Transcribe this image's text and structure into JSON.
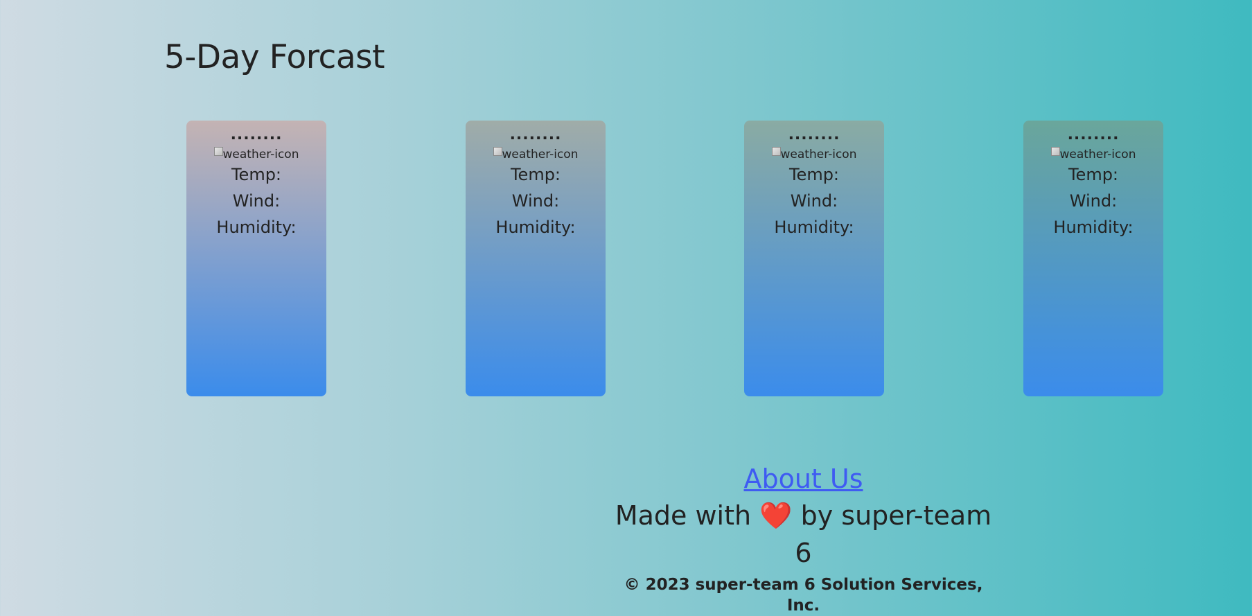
{
  "page": {
    "title": "5-Day Forcast"
  },
  "forecast": {
    "cards": [
      {
        "date": "........",
        "icon_alt": "weather-icon",
        "temp_label": "Temp:",
        "wind_label": "Wind:",
        "humidity_label": "Humidity:"
      },
      {
        "date": "........",
        "icon_alt": "weather-icon",
        "temp_label": "Temp:",
        "wind_label": "Wind:",
        "humidity_label": "Humidity:"
      },
      {
        "date": "........",
        "icon_alt": "weather-icon",
        "temp_label": "Temp:",
        "wind_label": "Wind:",
        "humidity_label": "Humidity:"
      },
      {
        "date": "........",
        "icon_alt": "weather-icon",
        "temp_label": "Temp:",
        "wind_label": "Wind:",
        "humidity_label": "Humidity:"
      }
    ],
    "card_colors": {
      "card_1_top": "#c4b3b3",
      "card_2_top": "#a0aca8",
      "card_3_top": "#8aaba3",
      "card_4_top": "#6aa69b",
      "bottom": "#3b8ceb"
    }
  },
  "footer": {
    "about_label": "About Us",
    "made_with_prefix": "Made with",
    "heart_icon": "❤️",
    "made_with_suffix": "by super-team 6",
    "copyright": "© 2023 super-team 6 Solution Services, Inc."
  },
  "colors": {
    "link": "#3f5bf2",
    "text": "#222222",
    "background_left": "#cfdbe3",
    "background_right": "#3fbac0"
  }
}
